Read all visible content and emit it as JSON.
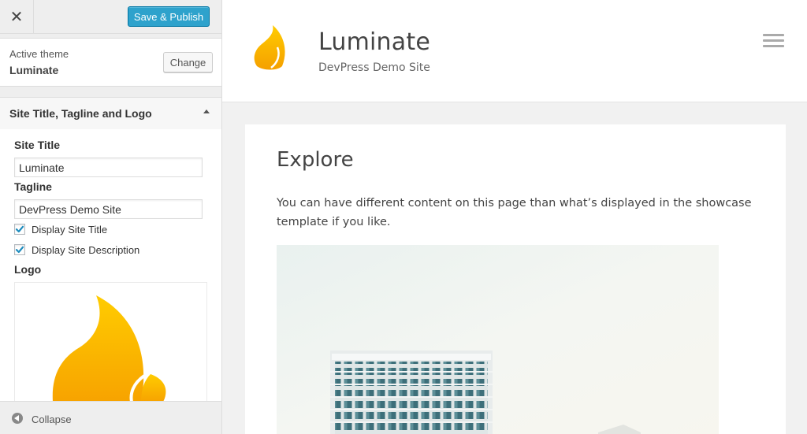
{
  "sidebar": {
    "close_glyph": "✕",
    "publish_label": "Save & Publish",
    "theme": {
      "label": "Active theme",
      "name": "Luminate",
      "change_label": "Change"
    },
    "section": {
      "title": "Site Title, Tagline and Logo",
      "site_title_label": "Site Title",
      "site_title_value": "Luminate",
      "tagline_label": "Tagline",
      "tagline_value": "DevPress Demo Site",
      "display_title_label": "Display Site Title",
      "display_title_checked": true,
      "display_description_label": "Display Site Description",
      "display_description_checked": true,
      "logo_label": "Logo"
    },
    "collapse_label": "Collapse"
  },
  "preview": {
    "site_title": "Luminate",
    "site_tagline": "DevPress Demo Site",
    "post_title": "Explore",
    "post_text": "You can have different content on this page than what’s displayed in the showcase template if you like."
  },
  "colors": {
    "accent": "#2ea2cc",
    "flame_light": "#ffcc00",
    "flame_dark": "#f5a000"
  },
  "icons": [
    "close-icon",
    "collapse-icon",
    "menu-icon",
    "checkmark-icon",
    "flame-logo-icon"
  ]
}
